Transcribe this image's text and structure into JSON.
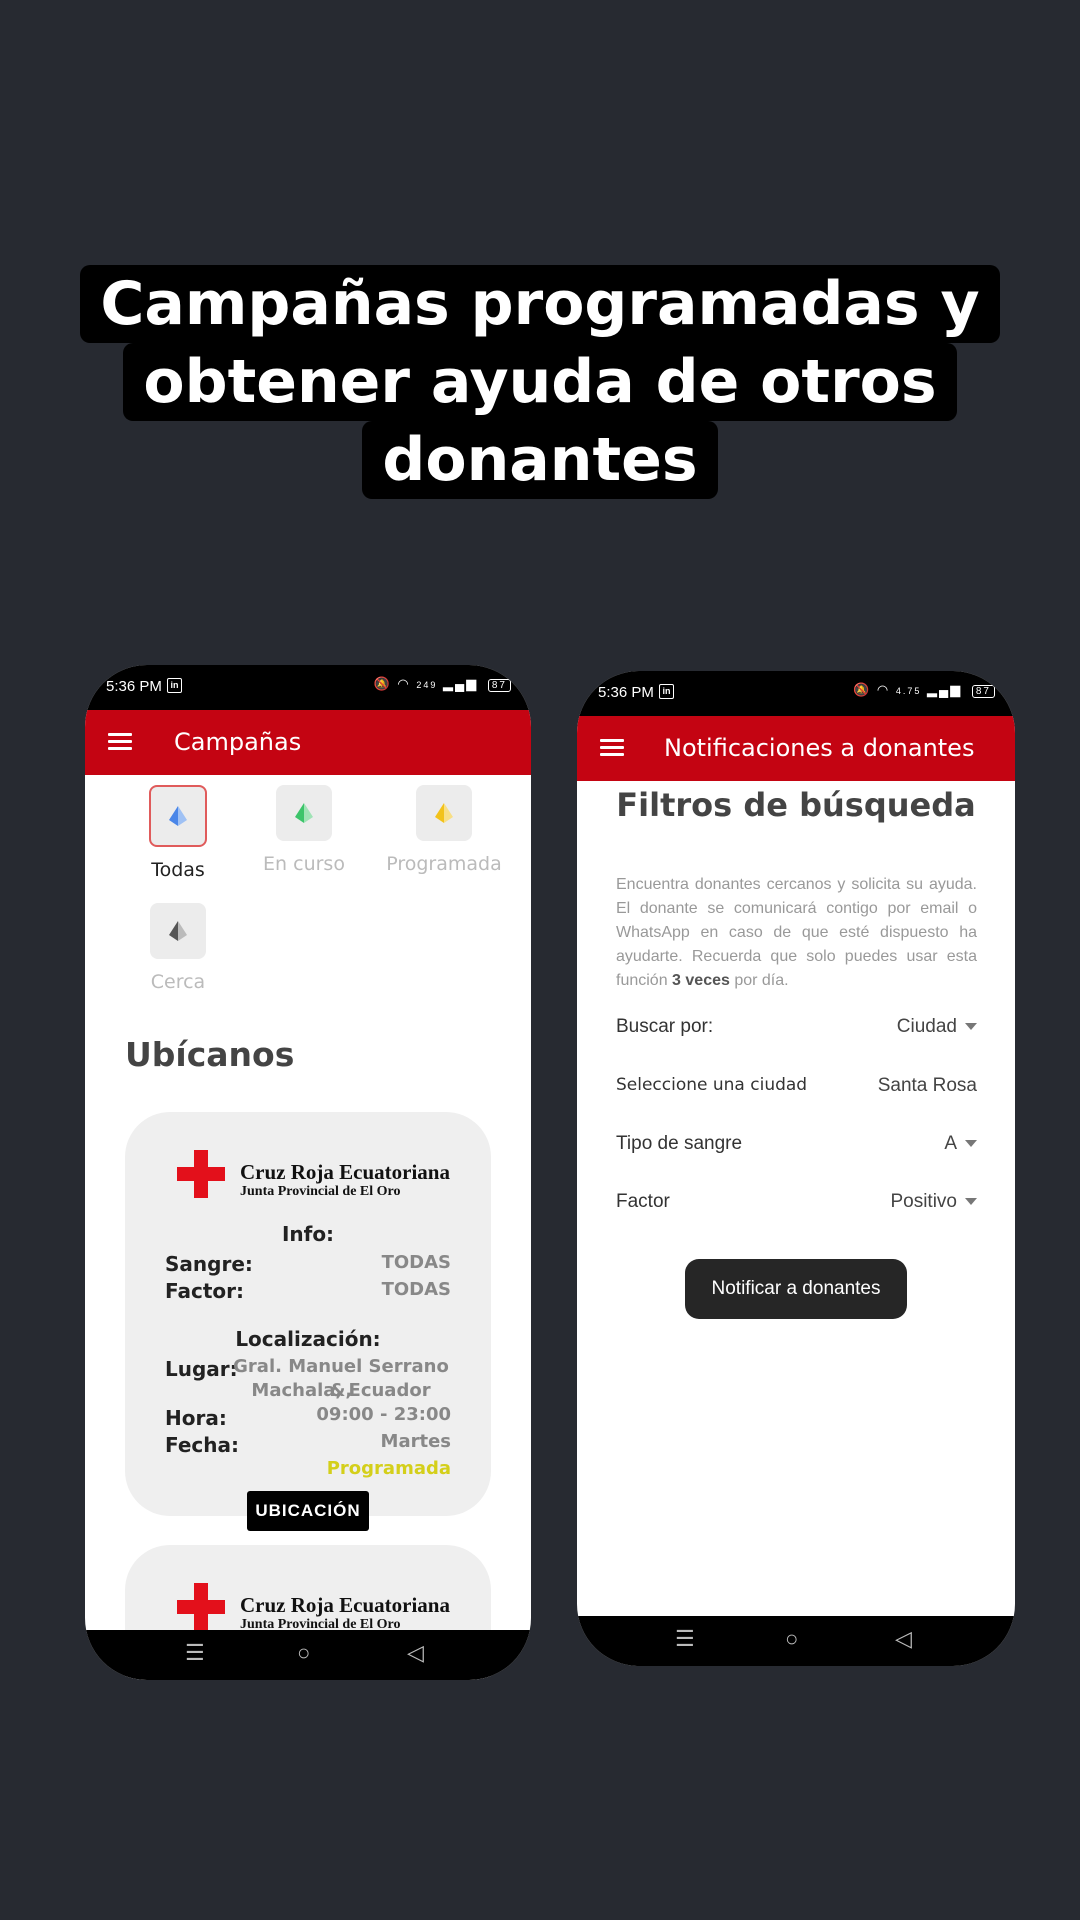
{
  "headline": {
    "line1": "Campañas programadas y",
    "line2": "obtener ayuda de otros",
    "line3": "donantes"
  },
  "left_phone": {
    "status": {
      "time": "5:36 PM",
      "battery": "87",
      "net_speed": "249"
    },
    "appbar_title": "Campañas",
    "filters": [
      {
        "label": "Todas",
        "color": "#4a86e8",
        "active": true
      },
      {
        "label": "En curso",
        "color": "#3cc46a",
        "active": false
      },
      {
        "label": "Programada",
        "color": "#f2c21a",
        "active": false
      },
      {
        "label": "Cerca",
        "color": "#555555",
        "active": false
      }
    ],
    "section_title": "Ubícanos",
    "card": {
      "org_name": "Cruz Roja Ecuatoriana",
      "org_sub": "Junta Provincial de El Oro",
      "info_heading": "Info:",
      "sangre_label": "Sangre:",
      "sangre_value": "TODAS",
      "factor_label": "Factor:",
      "factor_value": "TODAS",
      "loc_heading": "Localización:",
      "lugar_label": "Lugar:",
      "lugar_line1": "Gral. Manuel Serrano &,",
      "lugar_line2": "Machala, Ecuador",
      "hora_label": "Hora:",
      "hora_value": "09:00 - 23:00",
      "fecha_label": "Fecha:",
      "fecha_value": "Martes",
      "status_value": "Programada",
      "button_label": "UBICACIÓN"
    },
    "card2": {
      "org_name": "Cruz Roja Ecuatoriana",
      "org_sub": "Junta Provincial de El Oro"
    }
  },
  "right_phone": {
    "status": {
      "time": "5:36 PM",
      "battery": "87",
      "net_speed": "4.75"
    },
    "appbar_title": "Notificaciones a donantes",
    "title": "Filtros de búsqueda",
    "description_pre": "Encuentra donantes cercanos y solicita su ayuda. El donante se comunicará contigo por email o WhatsApp en caso de que esté dispuesto ha ayudarte. Recuerda que solo puedes usar esta función ",
    "description_bold": "3 veces",
    "description_post": " por día.",
    "rows": [
      {
        "label": "Buscar por:",
        "value": "Ciudad",
        "dropdown": true
      },
      {
        "label": "Seleccione una ciudad",
        "value": "Santa Rosa",
        "dropdown": false
      },
      {
        "label": "Tipo de sangre",
        "value": "A",
        "dropdown": true
      },
      {
        "label": "Factor",
        "value": "Positivo",
        "dropdown": true
      }
    ],
    "button_label": "Notificar a donantes"
  }
}
